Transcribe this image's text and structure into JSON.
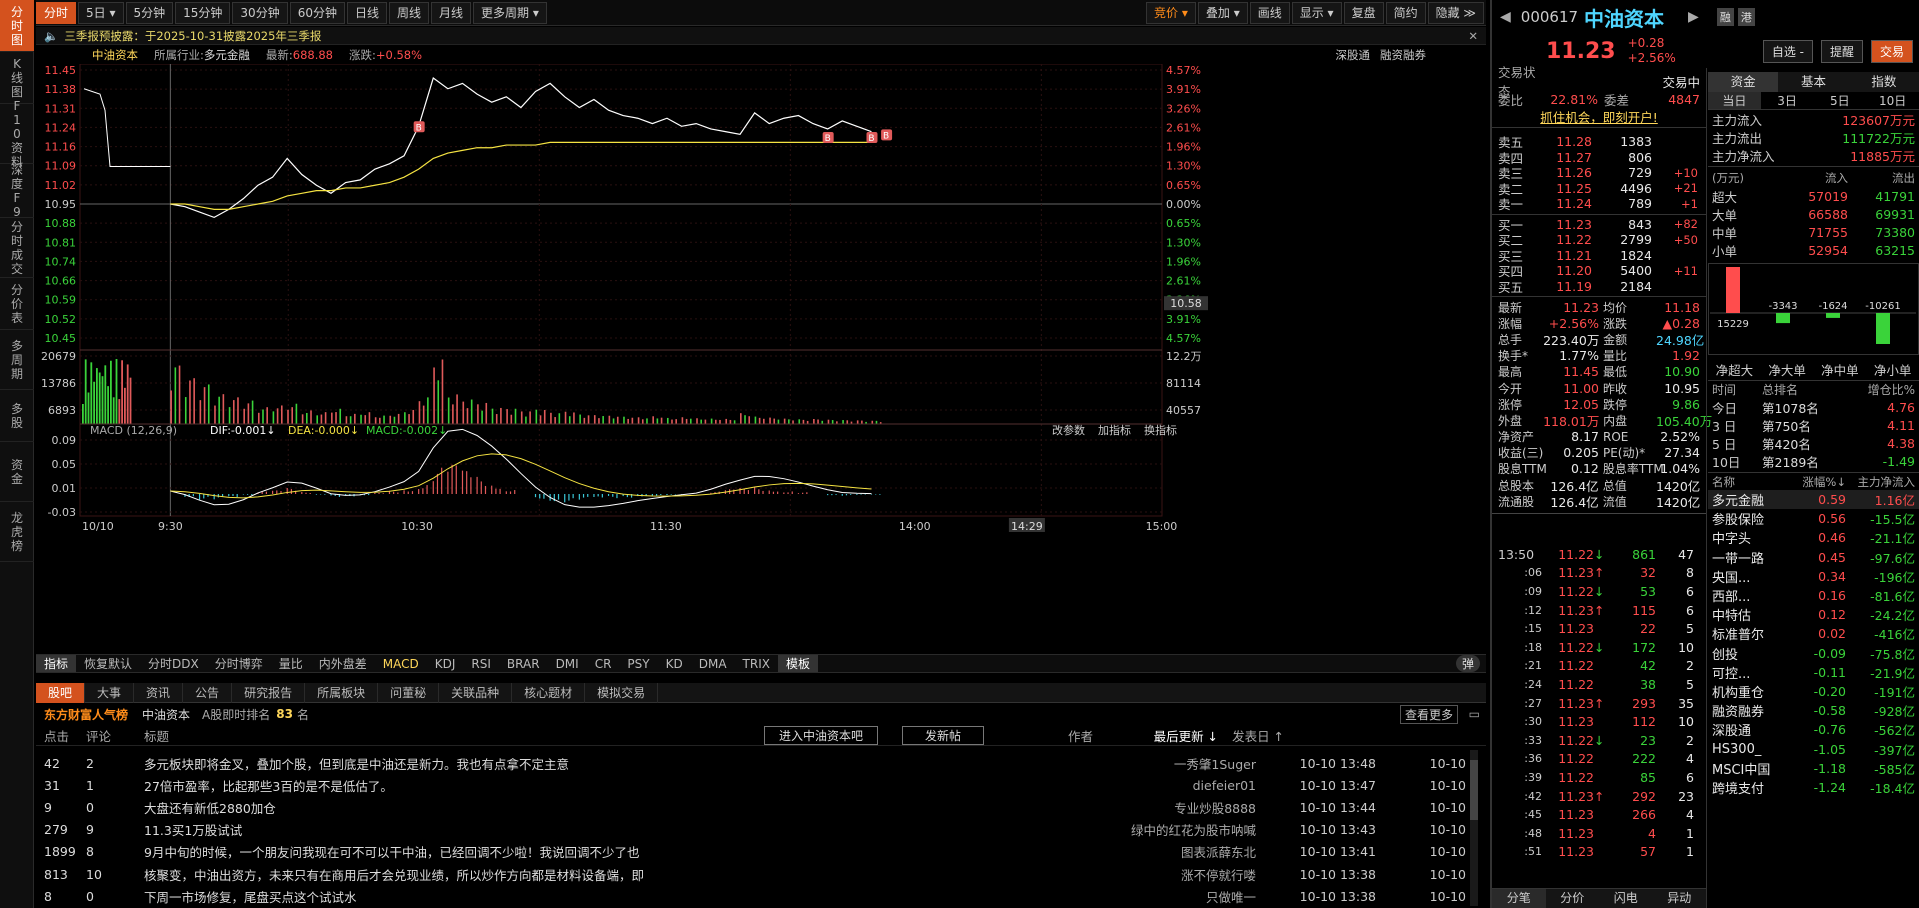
{
  "left_tabs": [
    {
      "label": "分时图",
      "active": true
    },
    {
      "label": "K线图"
    },
    {
      "label": "F10资料"
    },
    {
      "label": "深度F9"
    },
    {
      "label": "分时成交"
    },
    {
      "label": "分价表"
    },
    {
      "label": "多周期"
    },
    {
      "label": "多股"
    },
    {
      "label": "资金"
    },
    {
      "label": "龙虎榜"
    }
  ],
  "toolbar": {
    "periods": [
      "分时",
      "5日 ▾",
      "5分钟",
      "15分钟",
      "30分钟",
      "60分钟",
      "日线",
      "周线",
      "月线",
      "更多周期 ▾"
    ],
    "right_tools": [
      "竞价 ▾",
      "叠加 ▾",
      "画线",
      "显示 ▾",
      "复盘",
      "简约",
      "隐藏 ≫"
    ]
  },
  "notice": "三季报预披露：于2025-10-31披露2025年三季报",
  "chart_info": {
    "name": "中油资本",
    "industry_label": "所属行业:",
    "industry": "多元金融",
    "latest_label": "最新:",
    "latest": "688.88",
    "change_label": "涨跌:",
    "change": "+0.58%",
    "links": [
      "深股通",
      "融资融券"
    ]
  },
  "chart_data": [
    {
      "type": "line",
      "title": "分时",
      "x": [
        "09:30",
        "10:30",
        "11:30",
        "14:00",
        "15:00"
      ],
      "x_tick_labels": [
        "10/10",
        "9:30",
        "10:30",
        "11:30",
        "14:00",
        "15:00"
      ],
      "cursor_time": "14:29",
      "prev_close": 10.95,
      "y_ticks_price": [
        "11.45",
        "11.38",
        "11.31",
        "11.24",
        "11.16",
        "11.09",
        "11.02",
        "10.95",
        "10.88",
        "10.81",
        "10.74",
        "10.66",
        "10.59",
        "10.52",
        "10.45"
      ],
      "y_ticks_pct": [
        "4.57%",
        "3.91%",
        "3.26%",
        "2.61%",
        "1.96%",
        "1.30%",
        "0.65%",
        "0.00%",
        "0.65%",
        "1.30%",
        "1.96%",
        "2.61%",
        "3.26%",
        "3.91%",
        "4.57%"
      ],
      "cursor_price": "10.58",
      "series": [
        {
          "name": "价格",
          "color": "#ffffff",
          "values": [
            10.95,
            10.94,
            10.92,
            10.9,
            10.93,
            10.97,
            11.02,
            11.05,
            11.12,
            11.06,
            11.02,
            10.99,
            11.03,
            11.04,
            11.08,
            11.1,
            11.13,
            11.24,
            11.42,
            11.38,
            11.4,
            11.36,
            11.33,
            11.35,
            11.31,
            11.37,
            11.4,
            11.35,
            11.31,
            11.34,
            11.3,
            11.28,
            11.27,
            11.25,
            11.27,
            11.24,
            11.25,
            11.23,
            11.22,
            11.21,
            11.29,
            11.25,
            11.27,
            11.28,
            11.25,
            11.23,
            11.26,
            11.24,
            11.22
          ]
        },
        {
          "name": "均价",
          "color": "#f5e342",
          "values": [
            10.95,
            10.95,
            10.94,
            10.93,
            10.93,
            10.94,
            10.95,
            10.96,
            10.98,
            10.99,
            11.0,
            11.0,
            11.01,
            11.01,
            11.02,
            11.03,
            11.05,
            11.08,
            11.12,
            11.14,
            11.15,
            11.16,
            11.16,
            11.17,
            11.17,
            11.17,
            11.18,
            11.18,
            11.18,
            11.18,
            11.18,
            11.18,
            11.18,
            11.18,
            11.18,
            11.18,
            11.18,
            11.18,
            11.18,
            11.18,
            11.18,
            11.18,
            11.18,
            11.18,
            11.18,
            11.18,
            11.18,
            11.18,
            11.18
          ]
        }
      ],
      "markers": [
        "B",
        "B",
        "B",
        "B"
      ]
    },
    {
      "type": "bar",
      "title": "成交量",
      "y_ticks_left": [
        "20679",
        "13786",
        "6893"
      ],
      "y_ticks_right": [
        "12.2万",
        "81114",
        "40557"
      ],
      "values": [
        18000,
        14000,
        12000,
        9000,
        8000,
        7000,
        5000,
        5500,
        6000,
        4000,
        3500,
        4500,
        3000,
        3500,
        2500,
        3000,
        4200,
        8000,
        19500,
        9000,
        7500,
        6500,
        5000,
        4800,
        4000,
        4500,
        3500,
        3800,
        2900,
        2700,
        2500,
        2200,
        2000,
        2300,
        1800,
        2000,
        1700,
        1600,
        1500,
        3200,
        2200,
        1900,
        1600,
        1400,
        1500,
        1300,
        1200,
        1100,
        1000
      ]
    },
    {
      "type": "bar",
      "title": "MACD (12,26,9)",
      "legend": [
        {
          "label": "DIF:",
          "value": "-0.001↓",
          "color": "#ffffff"
        },
        {
          "label": "DEA:",
          "value": "-0.000↓",
          "color": "#f5e342"
        },
        {
          "label": "MACD:",
          "value": "-0.002↓",
          "color": "#3ad33a"
        }
      ],
      "y_ticks": [
        "0.09",
        "0.05",
        "0.01",
        "-0.03"
      ],
      "ylim": [
        -0.03,
        0.09
      ],
      "tools": [
        "改参数",
        "加指标",
        "换指标"
      ],
      "values": [
        0.0,
        -0.005,
        -0.01,
        -0.012,
        -0.008,
        -0.002,
        0.004,
        0.006,
        0.01,
        0.004,
        -0.002,
        -0.006,
        -0.004,
        -0.002,
        0.002,
        0.006,
        0.01,
        0.02,
        0.045,
        0.05,
        0.04,
        0.03,
        0.02,
        0.01,
        0.0,
        -0.008,
        -0.012,
        -0.014,
        -0.012,
        -0.01,
        -0.008,
        -0.006,
        -0.004,
        -0.003,
        -0.002,
        -0.001,
        0.0,
        0.004,
        0.008,
        0.01,
        0.012,
        0.009,
        0.006,
        0.003,
        0.0,
        -0.002,
        -0.003,
        -0.002,
        -0.002
      ]
    }
  ],
  "indicator_tabs": [
    "指标",
    "恢复默认",
    "分时DDX",
    "分时博弈",
    "量比",
    "内外盘差",
    "MACD",
    "KDJ",
    "RSI",
    "BRAR",
    "DMI",
    "CR",
    "PSY",
    "KD",
    "DMA",
    "TRIX",
    "模板"
  ],
  "popup_toggle": "弹",
  "forum": {
    "tabs": [
      "股吧",
      "大事",
      "资讯",
      "公告",
      "研究报告",
      "所属板块",
      "问董秘",
      "关联品种",
      "核心题材",
      "模拟交易"
    ],
    "brand": "东方财富人气榜",
    "stock": "中油资本",
    "rank_label": "A股即时排名",
    "rank": "83",
    "rank_unit": "名",
    "view_more": "查看更多",
    "enter_bar": "进入中油资本吧",
    "post_button": "发新帖",
    "headers": [
      "点击",
      "评论",
      "标题",
      "作者",
      "最后更新 ↓",
      "发表日 ↑"
    ],
    "rows": [
      {
        "clicks": "42",
        "comments": "2",
        "title": "多元板块即将金叉，叠加个股，但到底是中油还是新力。我也有点拿不定主意",
        "author": "一秀肇1Suger",
        "updated": "10-10 13:48",
        "posted": "10-10"
      },
      {
        "clicks": "31",
        "comments": "1",
        "title": "27倍市盈率，比起那些3百的是不是低估了。",
        "author": "diefeier01",
        "updated": "10-10 13:47",
        "posted": "10-10"
      },
      {
        "clicks": "9",
        "comments": "0",
        "title": "大盘还有新低2880加仓",
        "author": "专业炒股8888",
        "updated": "10-10 13:44",
        "posted": "10-10"
      },
      {
        "clicks": "279",
        "comments": "9",
        "title": "11.3买1万股试试",
        "author": "绿中的红花为股市呐喊",
        "updated": "10-10 13:43",
        "posted": "10-10"
      },
      {
        "clicks": "1899",
        "comments": "8",
        "title": "9月中旬的时候，一个朋友问我现在可不可以干中油，已经回调不少啦！我说回调不少了也",
        "author": "图表派薛东北",
        "updated": "10-10 13:41",
        "posted": "10-10"
      },
      {
        "clicks": "813",
        "comments": "10",
        "title": "核聚变，中油出资方，未来只有在商用后才会兑现业绩，所以炒作方向都是材料设备端，即",
        "author": "涨不停就行喽",
        "updated": "10-10 13:38",
        "posted": "10-10"
      },
      {
        "clicks": "8",
        "comments": "0",
        "title": "下周一市场修复，尾盘买点这个试试水",
        "author": "只做唯一",
        "updated": "10-10 13:38",
        "posted": "10-10"
      }
    ]
  },
  "quote": {
    "code": "000617",
    "name": "中油资本",
    "badges": [
      "融",
      "港"
    ],
    "price": "11.23",
    "change": "+0.28",
    "change_pct": "+2.56%",
    "buttons": [
      "自选 -",
      "提醒",
      "交易"
    ],
    "status_label": "交易状态",
    "status": "交易中",
    "webi_label": "委比",
    "webi": "22.81%",
    "weicha_label": "委差",
    "weicha": "4847",
    "promo": "抓住机会，即刻开户!",
    "asks": [
      {
        "label": "卖五",
        "price": "11.28",
        "vol": "1383",
        "chg": ""
      },
      {
        "label": "卖四",
        "price": "11.27",
        "vol": "806",
        "chg": ""
      },
      {
        "label": "卖三",
        "price": "11.26",
        "vol": "729",
        "chg": "+10"
      },
      {
        "label": "卖二",
        "price": "11.25",
        "vol": "4496",
        "chg": "+21"
      },
      {
        "label": "卖一",
        "price": "11.24",
        "vol": "789",
        "chg": "+1"
      }
    ],
    "bids": [
      {
        "label": "买一",
        "price": "11.23",
        "vol": "843",
        "chg": "+82"
      },
      {
        "label": "买二",
        "price": "11.22",
        "vol": "2799",
        "chg": "+50"
      },
      {
        "label": "买三",
        "price": "11.21",
        "vol": "1824",
        "chg": ""
      },
      {
        "label": "买四",
        "price": "11.20",
        "vol": "5400",
        "chg": "+11"
      },
      {
        "label": "买五",
        "price": "11.19",
        "vol": "2184",
        "chg": ""
      }
    ],
    "stats": [
      [
        "最新",
        "11.23",
        "red",
        "均价",
        "11.18",
        "red"
      ],
      [
        "涨幅",
        "+2.56%",
        "red",
        "涨跌",
        "▲0.28",
        "red"
      ],
      [
        "总手",
        "223.40万",
        "white",
        "金额",
        "24.98亿",
        "cyan"
      ],
      [
        "换手*",
        "1.77%",
        "white",
        "量比",
        "1.92",
        "red"
      ],
      [
        "最高",
        "11.45",
        "red",
        "最低",
        "10.90",
        "green"
      ],
      [
        "今开",
        "11.00",
        "red",
        "昨收",
        "10.95",
        "white"
      ],
      [
        "涨停",
        "12.05",
        "red",
        "跌停",
        "9.86",
        "green"
      ],
      [
        "外盘",
        "118.01万",
        "red",
        "内盘",
        "105.40万",
        "green"
      ],
      [
        "净资产",
        "8.17",
        "white",
        "ROE",
        "2.52%",
        "white"
      ],
      [
        "收益(三)",
        "0.205",
        "white",
        "PE(动)*",
        "27.34",
        "white"
      ],
      [
        "股息TTM",
        "0.12",
        "white",
        "股息率TTM",
        "1.04%",
        "white"
      ],
      [
        "总股本",
        "126.4亿",
        "white",
        "总值",
        "1420亿",
        "white"
      ],
      [
        "流通股",
        "126.4亿",
        "white",
        "流值",
        "1420亿",
        "white"
      ]
    ],
    "ticks": [
      {
        "t": "13:50",
        "p": "11.22",
        "a": "↓",
        "v": "861",
        "n": "47",
        "pc": "red",
        "vc": "green"
      },
      {
        "t": ":06",
        "p": "11.23",
        "a": "↑",
        "v": "32",
        "n": "8",
        "pc": "red",
        "vc": "red"
      },
      {
        "t": ":09",
        "p": "11.22",
        "a": "↓",
        "v": "53",
        "n": "6",
        "pc": "red",
        "vc": "green"
      },
      {
        "t": ":12",
        "p": "11.23",
        "a": "↑",
        "v": "115",
        "n": "6",
        "pc": "red",
        "vc": "red"
      },
      {
        "t": ":15",
        "p": "11.23",
        "a": "",
        "v": "22",
        "n": "5",
        "pc": "red",
        "vc": "red"
      },
      {
        "t": ":18",
        "p": "11.22",
        "a": "↓",
        "v": "172",
        "n": "10",
        "pc": "red",
        "vc": "green"
      },
      {
        "t": ":21",
        "p": "11.22",
        "a": "",
        "v": "42",
        "n": "2",
        "pc": "red",
        "vc": "green"
      },
      {
        "t": ":24",
        "p": "11.22",
        "a": "",
        "v": "38",
        "n": "5",
        "pc": "red",
        "vc": "green"
      },
      {
        "t": ":27",
        "p": "11.23",
        "a": "↑",
        "v": "293",
        "n": "35",
        "pc": "red",
        "vc": "red"
      },
      {
        "t": ":30",
        "p": "11.23",
        "a": "",
        "v": "112",
        "n": "10",
        "pc": "red",
        "vc": "red"
      },
      {
        "t": ":33",
        "p": "11.22",
        "a": "↓",
        "v": "23",
        "n": "2",
        "pc": "red",
        "vc": "green"
      },
      {
        "t": ":36",
        "p": "11.22",
        "a": "",
        "v": "222",
        "n": "4",
        "pc": "red",
        "vc": "green"
      },
      {
        "t": ":39",
        "p": "11.22",
        "a": "",
        "v": "85",
        "n": "6",
        "pc": "red",
        "vc": "green"
      },
      {
        "t": ":42",
        "p": "11.23",
        "a": "↑",
        "v": "292",
        "n": "23",
        "pc": "red",
        "vc": "red"
      },
      {
        "t": ":45",
        "p": "11.23",
        "a": "",
        "v": "266",
        "n": "4",
        "pc": "red",
        "vc": "red"
      },
      {
        "t": ":48",
        "p": "11.23",
        "a": "",
        "v": "4",
        "n": "1",
        "pc": "red",
        "vc": "red"
      },
      {
        "t": ":51",
        "p": "11.23",
        "a": "",
        "v": "57",
        "n": "1",
        "pc": "red",
        "vc": "red"
      }
    ],
    "bottom_tabs": [
      "分笔",
      "分价",
      "闪电",
      "异动"
    ]
  },
  "fund": {
    "tabs": [
      "资金",
      "基本",
      "指数"
    ],
    "day_tabs": [
      "当日",
      "3日",
      "5日",
      "10日"
    ],
    "flows": [
      {
        "label": "主力流入",
        "value": "123607万元",
        "color": "red"
      },
      {
        "label": "主力流出",
        "value": "111722万元",
        "color": "green"
      },
      {
        "label": "主力净流入",
        "value": "11885万元",
        "color": "red"
      }
    ],
    "table_head": [
      "(万元)",
      "流入",
      "流出"
    ],
    "table": [
      {
        "label": "超大",
        "in": "57019",
        "out": "41791"
      },
      {
        "label": "大单",
        "in": "66588",
        "out": "69931"
      },
      {
        "label": "中单",
        "in": "71755",
        "out": "73380"
      },
      {
        "label": "小单",
        "in": "52954",
        "out": "63215"
      }
    ],
    "net_bars": {
      "labels": [
        "净超大",
        "净大单",
        "净中单",
        "净小单"
      ],
      "values": [
        15229,
        -3343,
        -1624,
        -10261
      ],
      "value_labels": [
        "15229",
        "-3343",
        "-1624",
        "-10261"
      ]
    },
    "rank_head": [
      "时间",
      "总排名",
      "增仓比%"
    ],
    "rank": [
      {
        "time": "今日",
        "rank": "第1078名",
        "pct": "4.76"
      },
      {
        "time": "3 日",
        "rank": "第750名",
        "pct": "4.11"
      },
      {
        "time": "5 日",
        "rank": "第420名",
        "pct": "4.38"
      },
      {
        "time": "10日",
        "rank": "第2189名",
        "pct": "-1.49"
      }
    ],
    "sector_head": [
      "名称",
      "涨幅%↓",
      "主力净流入"
    ],
    "sectors": [
      {
        "name": "多元金融",
        "pct": "0.59",
        "flow": "1.16亿",
        "hl": true
      },
      {
        "name": "参股保险",
        "pct": "0.56",
        "flow": "-15.5亿"
      },
      {
        "name": "中字头",
        "pct": "0.46",
        "flow": "-21.1亿"
      },
      {
        "name": "一带一路",
        "pct": "0.45",
        "flow": "-97.6亿"
      },
      {
        "name": "央国...",
        "pct": "0.34",
        "flow": "-196亿"
      },
      {
        "name": "西部...",
        "pct": "0.16",
        "flow": "-81.6亿"
      },
      {
        "name": "中特估",
        "pct": "0.12",
        "flow": "-24.2亿"
      },
      {
        "name": "标准普尔",
        "pct": "0.02",
        "flow": "-416亿"
      },
      {
        "name": "创投",
        "pct": "-0.09",
        "flow": "-75.8亿"
      },
      {
        "name": "可控...",
        "pct": "-0.11",
        "flow": "-21.9亿"
      },
      {
        "name": "机构重仓",
        "pct": "-0.20",
        "flow": "-191亿"
      },
      {
        "name": "融资融券",
        "pct": "-0.58",
        "flow": "-928亿"
      },
      {
        "name": "深股通",
        "pct": "-0.76",
        "flow": "-562亿"
      },
      {
        "name": "HS300_",
        "pct": "-1.05",
        "flow": "-397亿"
      },
      {
        "name": "MSCI中国",
        "pct": "-1.18",
        "flow": "-585亿"
      },
      {
        "name": "跨境支付",
        "pct": "-1.24",
        "flow": "-18.4亿"
      }
    ]
  }
}
